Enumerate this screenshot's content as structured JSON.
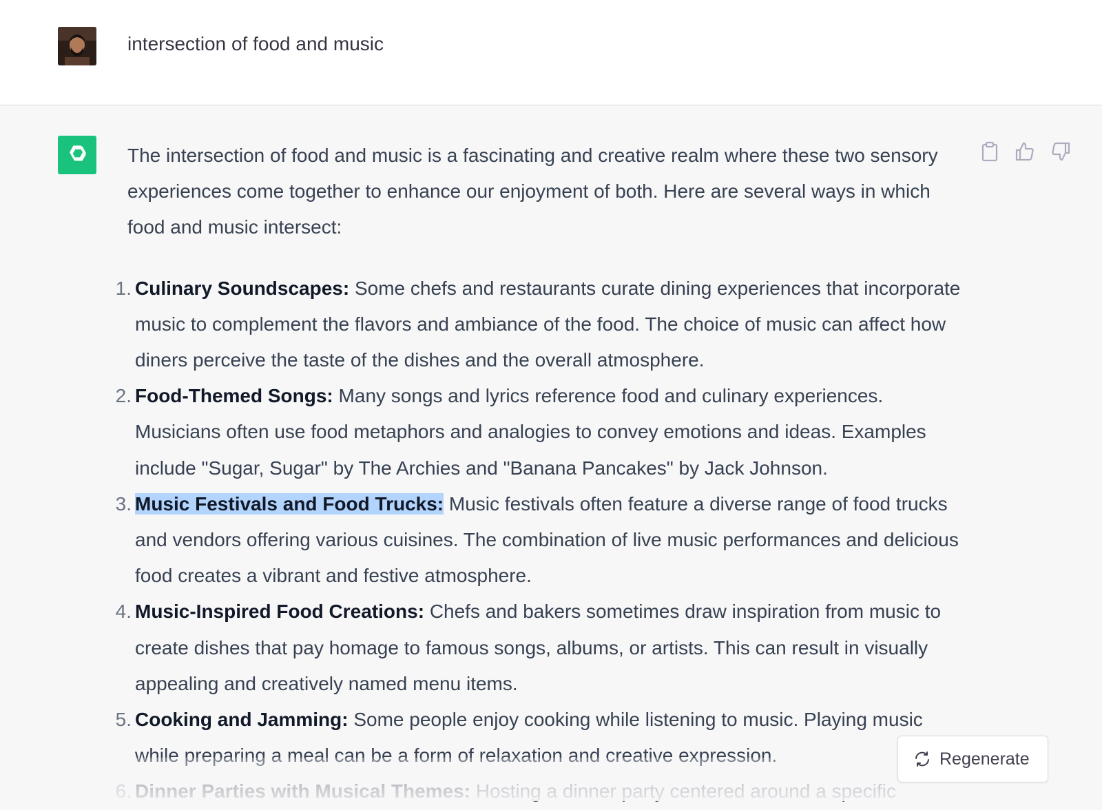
{
  "user": {
    "avatar": "user-avatar-photo",
    "message": "intersection of food and music"
  },
  "assistant": {
    "avatar_icon": "openai-logo-icon",
    "avatar_color": "#19c37d",
    "intro": "The intersection of food and music is a fascinating and creative realm where these two sensory experiences come together to enhance our enjoyment of both. Here are several ways in which food and music intersect:",
    "points": [
      {
        "number": "1.",
        "title": "Culinary Soundscapes:",
        "text": "Some chefs and restaurants curate dining experiences that incorporate music to complement the flavors and ambiance of the food. The choice of music can affect how diners perceive the taste of the dishes and the overall atmosphere."
      },
      {
        "number": "2.",
        "title": "Food-Themed Songs:",
        "text": "Many songs and lyrics reference food and culinary experiences. Musicians often use food metaphors and analogies to convey emotions and ideas. Examples include \"Sugar, Sugar\" by The Archies and \"Banana Pancakes\" by Jack Johnson."
      },
      {
        "number": "3.",
        "title": "Music Festivals and Food Trucks:",
        "text": "Music festivals often feature a diverse range of food trucks and vendors offering various cuisines. The combination of live music performances and delicious food creates a vibrant and festive atmosphere.",
        "highlighted": true
      },
      {
        "number": "4.",
        "title": "Music-Inspired Food Creations:",
        "text": "Chefs and bakers sometimes draw inspiration from music to create dishes that pay homage to famous songs, albums, or artists. This can result in visually appealing and creatively named menu items."
      },
      {
        "number": "5.",
        "title": "Cooking and Jamming:",
        "text": "Some people enjoy cooking while listening to music. Playing music while preparing a meal can be a form of relaxation and creative expression."
      },
      {
        "number": "6.",
        "title": "Dinner Parties with Musical Themes:",
        "text": "Hosting a dinner party centered around a specific"
      }
    ]
  },
  "actions": {
    "copy_icon": "clipboard-icon",
    "like_icon": "thumbs-up-icon",
    "dislike_icon": "thumbs-down-icon"
  },
  "regenerate": {
    "label": "Regenerate",
    "icon": "refresh-icon"
  },
  "colors": {
    "page_bg": "#f7f7f8",
    "user_bg": "#ffffff",
    "highlight": "#b3d4fc",
    "accent": "#19c37d"
  }
}
